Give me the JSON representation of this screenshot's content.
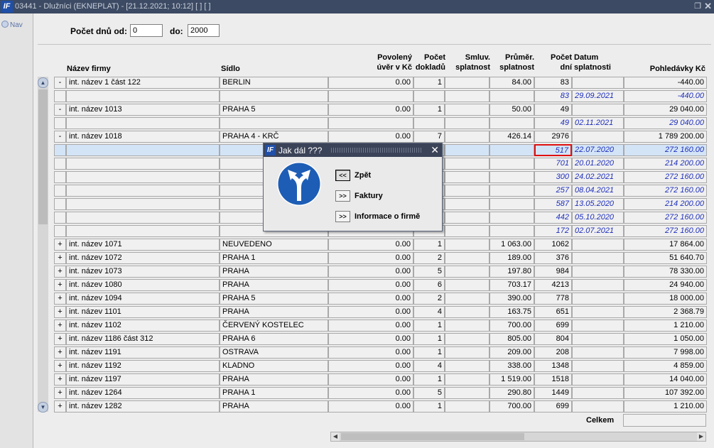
{
  "window": {
    "title": "03441 - Dlužníci (EKNEPLAT) - [21.12.2021; 10:12]  [ ]  [ ]",
    "logo": "IF"
  },
  "nav": {
    "label": "Nav"
  },
  "filter": {
    "from_label": "Počet dnů od:",
    "from_value": "0",
    "to_label": "do:",
    "to_value": "2000"
  },
  "columns": {
    "firm": "Název firmy",
    "seat": "Sídlo",
    "credit": [
      "Povolený",
      "úvěr v Kč"
    ],
    "docs": [
      "Počet",
      "dokladů"
    ],
    "agreed": [
      "Smluv.",
      "splatnost"
    ],
    "avg": [
      "Průměr.",
      "splatnost"
    ],
    "days": [
      "Počet",
      "dní"
    ],
    "due": [
      "Datum",
      "splatnosti"
    ],
    "recv": "Pohledávky Kč"
  },
  "rows": [
    {
      "t": "-",
      "firm": "int. název 1 část 122",
      "seat": "BERLIN",
      "credit": "0.00",
      "docs": "1",
      "agreed": "",
      "avg": "84.00",
      "days": "83",
      "due": "",
      "recv": "-440.00"
    },
    {
      "d": 1,
      "days": "83",
      "due": "29.09.2021",
      "recv": "-440.00"
    },
    {
      "t": "-",
      "firm": "int. název 1013",
      "seat": "PRAHA 5",
      "credit": "0.00",
      "docs": "1",
      "agreed": "",
      "avg": "50.00",
      "days": "49",
      "due": "",
      "recv": "29 040.00"
    },
    {
      "d": 1,
      "days": "49",
      "due": "02.11.2021",
      "recv": "29 040.00"
    },
    {
      "t": "-",
      "firm": "int. název 1018",
      "seat": "PRAHA 4 - KRČ",
      "credit": "0.00",
      "docs": "7",
      "agreed": "",
      "avg": "426.14",
      "days": "2976",
      "due": "",
      "recv": "1 789 200.00"
    },
    {
      "d": 1,
      "sel": 1,
      "days": "517",
      "due": "22.07.2020",
      "recv": "272 160.00"
    },
    {
      "d": 1,
      "days": "701",
      "due": "20.01.2020",
      "recv": "214 200.00"
    },
    {
      "d": 1,
      "days": "300",
      "due": "24.02.2021",
      "recv": "272 160.00"
    },
    {
      "d": 1,
      "days": "257",
      "due": "08.04.2021",
      "recv": "272 160.00"
    },
    {
      "d": 1,
      "days": "587",
      "due": "13.05.2020",
      "recv": "214 200.00"
    },
    {
      "d": 1,
      "days": "442",
      "due": "05.10.2020",
      "recv": "272 160.00"
    },
    {
      "d": 1,
      "days": "172",
      "due": "02.07.2021",
      "recv": "272 160.00"
    },
    {
      "t": "+",
      "firm": "int. název 1071",
      "seat": "NEUVEDENO",
      "credit": "0.00",
      "docs": "1",
      "agreed": "",
      "avg": "1 063.00",
      "days": "1062",
      "due": "",
      "recv": "17 864.00"
    },
    {
      "t": "+",
      "firm": "int. název 1072",
      "seat": "PRAHA 1",
      "credit": "0.00",
      "docs": "2",
      "agreed": "",
      "avg": "189.00",
      "days": "376",
      "due": "",
      "recv": "51 640.70"
    },
    {
      "t": "+",
      "firm": "int. název 1073",
      "seat": "PRAHA",
      "credit": "0.00",
      "docs": "5",
      "agreed": "",
      "avg": "197.80",
      "days": "984",
      "due": "",
      "recv": "78 330.00"
    },
    {
      "t": "+",
      "firm": "int. název 1080",
      "seat": "PRAHA",
      "credit": "0.00",
      "docs": "6",
      "agreed": "",
      "avg": "703.17",
      "days": "4213",
      "due": "",
      "recv": "24 940.00"
    },
    {
      "t": "+",
      "firm": "int. název 1094",
      "seat": "PRAHA 5",
      "credit": "0.00",
      "docs": "2",
      "agreed": "",
      "avg": "390.00",
      "days": "778",
      "due": "",
      "recv": "18 000.00"
    },
    {
      "t": "+",
      "firm": "int. název 1101",
      "seat": "PRAHA",
      "credit": "0.00",
      "docs": "4",
      "agreed": "",
      "avg": "163.75",
      "days": "651",
      "due": "",
      "recv": "2 368.79"
    },
    {
      "t": "+",
      "firm": "int. název 1102",
      "seat": "ČERVENÝ KOSTELEC",
      "credit": "0.00",
      "docs": "1",
      "agreed": "",
      "avg": "700.00",
      "days": "699",
      "due": "",
      "recv": "1 210.00"
    },
    {
      "t": "+",
      "firm": "int. název 1186 část 312",
      "seat": "PRAHA 6",
      "credit": "0.00",
      "docs": "1",
      "agreed": "",
      "avg": "805.00",
      "days": "804",
      "due": "",
      "recv": "1 050.00"
    },
    {
      "t": "+",
      "firm": "int. název 1191",
      "seat": "OSTRAVA",
      "credit": "0.00",
      "docs": "1",
      "agreed": "",
      "avg": "209.00",
      "days": "208",
      "due": "",
      "recv": "7 998.00"
    },
    {
      "t": "+",
      "firm": "int. název 1192",
      "seat": "KLADNO",
      "credit": "0.00",
      "docs": "4",
      "agreed": "",
      "avg": "338.00",
      "days": "1348",
      "due": "",
      "recv": "4 859.00"
    },
    {
      "t": "+",
      "firm": "int. název 1197",
      "seat": "PRAHA",
      "credit": "0.00",
      "docs": "1",
      "agreed": "",
      "avg": "1 519.00",
      "days": "1518",
      "due": "",
      "recv": "14 040.00"
    },
    {
      "t": "+",
      "firm": "int. název 1264",
      "seat": "PRAHA 1",
      "credit": "0.00",
      "docs": "5",
      "agreed": "",
      "avg": "290.80",
      "days": "1449",
      "due": "",
      "recv": "107 392.00"
    },
    {
      "t": "+",
      "firm": "int. název 1282",
      "seat": "PRAHA",
      "credit": "0.00",
      "docs": "1",
      "agreed": "",
      "avg": "700.00",
      "days": "699",
      "due": "",
      "recv": "1 210.00"
    }
  ],
  "footer": {
    "total_label": "Celkem",
    "total_value": ""
  },
  "dialog": {
    "title": "Jak dál ???",
    "icon": "fork-road-sign-icon",
    "options": [
      {
        "btn": "<<",
        "label": "Zpět"
      },
      {
        "btn": ">>",
        "label": "Faktury"
      },
      {
        "btn": ">>",
        "label": "Informace o firmě"
      }
    ]
  },
  "colors": {
    "titlebar": "#3c4a63",
    "selection": "#d3e4f7",
    "detail_text": "#1f2fbb",
    "highlight_border": "#e01010",
    "sign_blue": "#1d5db5"
  }
}
